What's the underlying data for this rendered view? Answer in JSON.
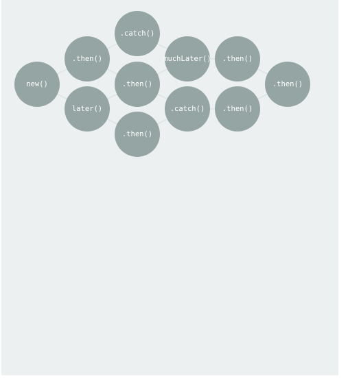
{
  "diagram": {
    "nodes": [
      {
        "id": "new",
        "label": "new()"
      },
      {
        "id": "then1",
        "label": ".then()"
      },
      {
        "id": "later",
        "label": "later()"
      },
      {
        "id": "catch1",
        "label": ".catch()"
      },
      {
        "id": "then2",
        "label": ".then()"
      },
      {
        "id": "then3",
        "label": ".then()"
      },
      {
        "id": "muchLater",
        "label": "muchLater()"
      },
      {
        "id": "catch2",
        "label": ".catch()"
      },
      {
        "id": "then4",
        "label": ".then()"
      },
      {
        "id": "then5",
        "label": ".then()"
      },
      {
        "id": "then6",
        "label": ".then()"
      }
    ],
    "edges": [
      [
        "new",
        "then1"
      ],
      [
        "new",
        "later"
      ],
      [
        "then1",
        "catch1"
      ],
      [
        "then1",
        "then2"
      ],
      [
        "later",
        "then2"
      ],
      [
        "later",
        "then3"
      ],
      [
        "catch1",
        "muchLater"
      ],
      [
        "then2",
        "muchLater"
      ],
      [
        "then2",
        "catch2"
      ],
      [
        "then3",
        "catch2"
      ],
      [
        "muchLater",
        "then4"
      ],
      [
        "catch2",
        "then5"
      ],
      [
        "then4",
        "then6"
      ],
      [
        "then5",
        "then6"
      ]
    ],
    "colors": {
      "node": "#95a5a3",
      "edge": "#dde3e5",
      "label": "#ffffff",
      "background": "#ecf0f1"
    }
  }
}
